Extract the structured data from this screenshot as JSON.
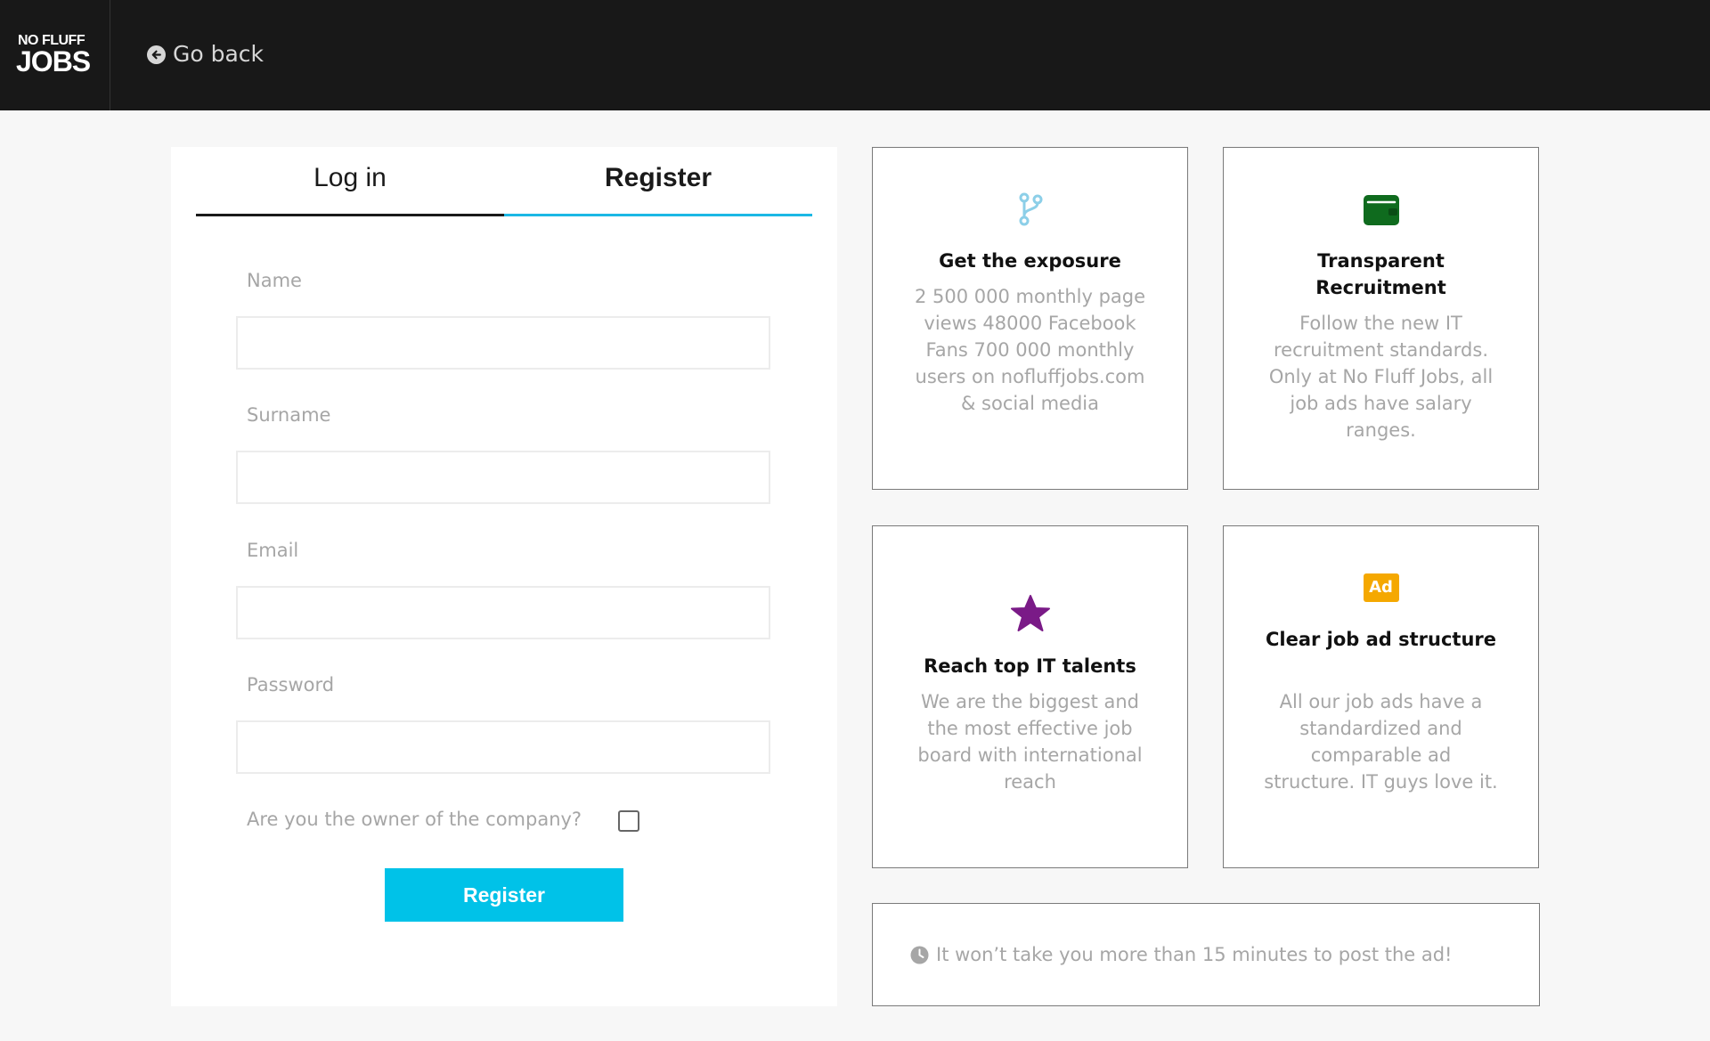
{
  "header": {
    "logo_top": "NO FLUFF",
    "logo_bottom": "JOBS",
    "go_back_label": "Go back"
  },
  "tabs": {
    "login": "Log in",
    "register": "Register"
  },
  "form": {
    "name_label": "Name",
    "name_value": "",
    "surname_label": "Surname",
    "surname_value": "",
    "email_label": "Email",
    "email_value": "",
    "password_label": "Password",
    "password_value": "",
    "owner_question": "Are you the owner of the company?",
    "owner_checked": false,
    "submit_label": "Register"
  },
  "features": [
    {
      "icon": "branch-icon",
      "title": "Get the exposure",
      "text": "2 500 000 monthly page views 48000 Facebook Fans 700 000 monthly users on nofluffjobs.com & social media"
    },
    {
      "icon": "wallet-icon",
      "title": "Transparent Recruitment",
      "text": "Follow the new IT recruitment standards. Only at No Fluff Jobs, all job ads have salary ranges."
    },
    {
      "icon": "star-icon",
      "title": "Reach top IT talents",
      "text": "We are the biggest and the most effective job board with international reach"
    },
    {
      "icon": "ad-icon",
      "icon_text": "Ad",
      "title": "Clear job ad structure",
      "text": "All our job ads have a standardized and comparable ad structure. IT guys love it."
    }
  ],
  "note": {
    "text": "It won’t take you more than 15 minutes to post the ad!"
  },
  "colors": {
    "header_bg": "#181818",
    "accent": "#00c2e8",
    "tab_underline": "#1cb8e5",
    "branch_icon": "#8ccfe8",
    "wallet_icon": "#0f6b1e",
    "star_icon": "#7a1a87",
    "ad_icon": "#f5a800"
  }
}
